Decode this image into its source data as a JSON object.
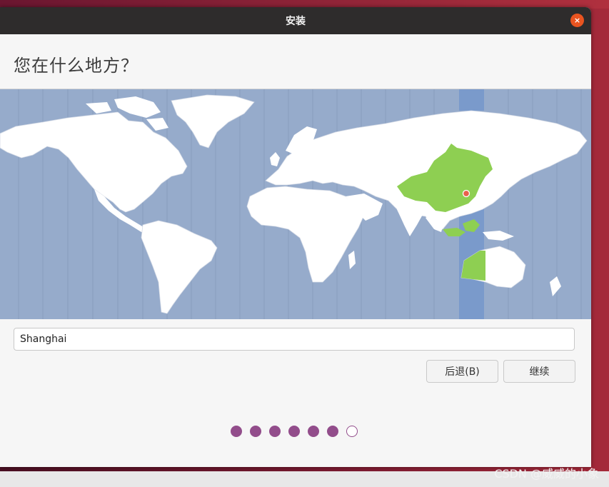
{
  "window": {
    "title": "安装",
    "close_glyph": "×"
  },
  "page": {
    "heading": "您在什么地方？"
  },
  "map": {
    "ocean_color": "#96abcb",
    "land_color": "#ffffff",
    "selected_region_color": "#8ecf52",
    "timezone_band_color": "#7a9acb",
    "marker_color": "#e8604c",
    "selected_city": "Shanghai"
  },
  "location": {
    "value": "Shanghai"
  },
  "buttons": {
    "back_label": "后退(B)",
    "continue_label": "继续"
  },
  "progress": {
    "total_steps": 7,
    "completed_steps": 6,
    "dot_color": "#924d8b"
  },
  "watermark": "CSDN @威威的小象"
}
